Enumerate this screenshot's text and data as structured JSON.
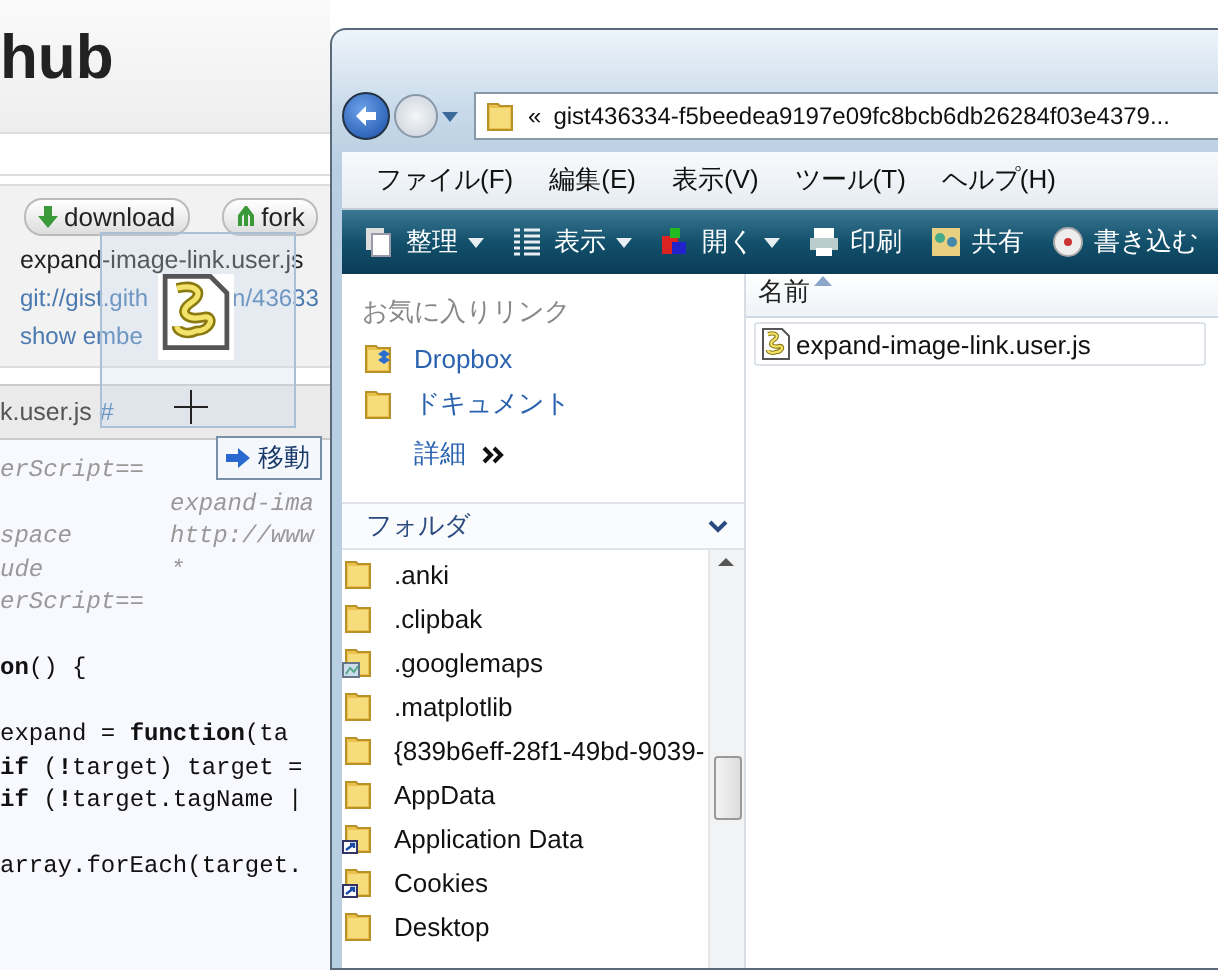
{
  "web_page": {
    "logo": "hub",
    "buttons": [
      {
        "label": "download",
        "kind": "download"
      },
      {
        "label": "fork",
        "kind": "fork"
      }
    ],
    "file_name": "expand-image-link.user.js",
    "clone_url": [
      "git://gist.gith",
      "n/43633"
    ],
    "embed_link": "show embe",
    "file_tab": "k.user.js",
    "anchor": "#",
    "code_lines": [
      {
        "kind": "comment",
        "text": "erScript=="
      },
      {
        "kind": "comment",
        "value": "expand-ima"
      },
      {
        "kind": "comment",
        "text": "space",
        "value": "http://www"
      },
      {
        "kind": "comment",
        "text": "ude",
        "value": "*"
      },
      {
        "kind": "comment",
        "text": "erScript=="
      },
      {
        "kind": "blank"
      },
      {
        "kind": "code",
        "text": "**on**() {"
      },
      {
        "kind": "blank"
      },
      {
        "kind": "code",
        "text": "expand = **function**(ta"
      },
      {
        "kind": "code",
        "text": "**if** (**!**target) target ="
      },
      {
        "kind": "code",
        "text": "**if** (**!**target.tagName |"
      },
      {
        "kind": "blank"
      },
      {
        "kind": "code",
        "text": "array.forEach(target."
      }
    ]
  },
  "explorer": {
    "address_prefix": "«",
    "address": "gist436334-f5beedea9197e09fc8bcb6db26284f03e4379...",
    "menu": [
      "ファイル(F)",
      "編集(E)",
      "表示(V)",
      "ツール(T)",
      "ヘルプ(H)"
    ],
    "toolbar": [
      {
        "label": "整理",
        "kind": "organize",
        "dropdown": true
      },
      {
        "label": "表示",
        "kind": "views",
        "dropdown": true
      },
      {
        "label": "開く",
        "kind": "open",
        "dropdown": true
      },
      {
        "label": "印刷",
        "kind": "print",
        "dropdown": false
      },
      {
        "label": "共有",
        "kind": "share",
        "dropdown": false
      },
      {
        "label": "書き込む",
        "kind": "burn",
        "dropdown": false
      }
    ],
    "favorites": {
      "title": "お気に入りリンク",
      "items": [
        {
          "label": "Dropbox",
          "kind": "dropbox"
        },
        {
          "label": "ドキュメント",
          "kind": "folder"
        }
      ],
      "more": "詳細"
    },
    "folders": {
      "title": "フォルダ",
      "expanded": true,
      "items": [
        {
          "label": ".anki",
          "kind": "folder"
        },
        {
          "label": ".clipbak",
          "kind": "folder"
        },
        {
          "label": ".googlemaps",
          "kind": "special"
        },
        {
          "label": ".matplotlib",
          "kind": "folder"
        },
        {
          "label": "{839b6eff-28f1-49bd-9039-",
          "kind": "folder"
        },
        {
          "label": "AppData",
          "kind": "folder"
        },
        {
          "label": "Application Data",
          "kind": "shortcut"
        },
        {
          "label": "Cookies",
          "kind": "shortcut"
        },
        {
          "label": "Desktop",
          "kind": "folder"
        }
      ]
    },
    "columns": [
      {
        "label": "名前",
        "sorted": true
      }
    ],
    "files": [
      {
        "name": "expand-image-link.user.js",
        "kind": "script"
      }
    ]
  },
  "drag": {
    "tooltip": "移動"
  }
}
